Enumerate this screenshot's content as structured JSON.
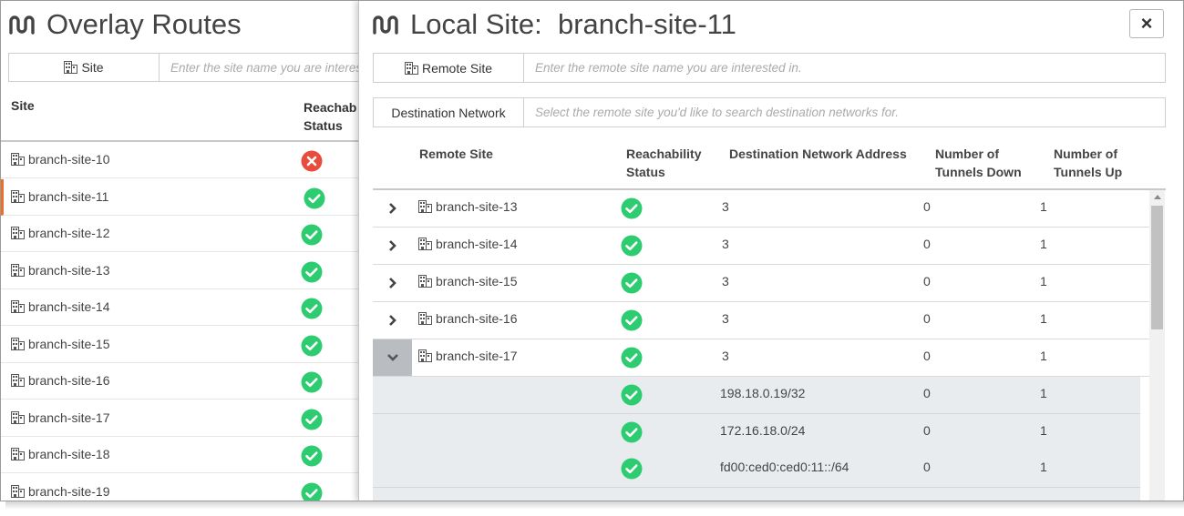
{
  "colors": {
    "accent": "#e8702a",
    "ok": "#2ecc71",
    "error": "#e74c3c",
    "expanded_bg": "#b9bcc0",
    "subrow_bg": "#e9ecee"
  },
  "left_panel": {
    "title": "Overlay Routes",
    "filter": {
      "label": "Site",
      "placeholder": "Enter the site name you are interested in."
    },
    "columns": [
      "Site",
      "Reachability\nStatus"
    ],
    "rows": [
      {
        "name": "branch-site-10",
        "status": "error"
      },
      {
        "name": "branch-site-11",
        "status": "ok"
      },
      {
        "name": "branch-site-12",
        "status": "ok"
      },
      {
        "name": "branch-site-13",
        "status": "ok"
      },
      {
        "name": "branch-site-14",
        "status": "ok"
      },
      {
        "name": "branch-site-15",
        "status": "ok"
      },
      {
        "name": "branch-site-16",
        "status": "ok"
      },
      {
        "name": "branch-site-17",
        "status": "ok"
      },
      {
        "name": "branch-site-18",
        "status": "ok"
      },
      {
        "name": "branch-site-19",
        "status": "ok"
      }
    ]
  },
  "right_panel": {
    "title": "Local Site:  branch-site-11",
    "close_label": "×",
    "filter_remote": {
      "label": "Remote Site",
      "placeholder": "Enter the remote site name you are interested in."
    },
    "filter_dest": {
      "label": "Destination Network",
      "placeholder": "Select the remote site you'd like to search destination networks for."
    },
    "columns": {
      "remote_site": "Remote Site",
      "reachability": "Reachability\nStatus",
      "dest_address": "Destination Network Address",
      "tunnels_down": "Number of\nTunnels Down",
      "tunnels_up": "Number of\nTunnels Up"
    },
    "rows": [
      {
        "name": "branch-site-13",
        "status": "ok",
        "dest": "3",
        "down": "0",
        "up": "1",
        "expanded": false
      },
      {
        "name": "branch-site-14",
        "status": "ok",
        "dest": "3",
        "down": "0",
        "up": "1",
        "expanded": false
      },
      {
        "name": "branch-site-15",
        "status": "ok",
        "dest": "3",
        "down": "0",
        "up": "1",
        "expanded": false
      },
      {
        "name": "branch-site-16",
        "status": "ok",
        "dest": "3",
        "down": "0",
        "up": "1",
        "expanded": false
      },
      {
        "name": "branch-site-17",
        "status": "ok",
        "dest": "3",
        "down": "0",
        "up": "1",
        "expanded": true
      }
    ],
    "subrows": [
      {
        "status": "ok",
        "dest": "198.18.0.19/32",
        "down": "0",
        "up": "1"
      },
      {
        "status": "ok",
        "dest": "172.16.18.0/24",
        "down": "0",
        "up": "1"
      },
      {
        "status": "ok",
        "dest": "fd00:ced0:ced0:11::/64",
        "down": "0",
        "up": "1"
      }
    ]
  }
}
